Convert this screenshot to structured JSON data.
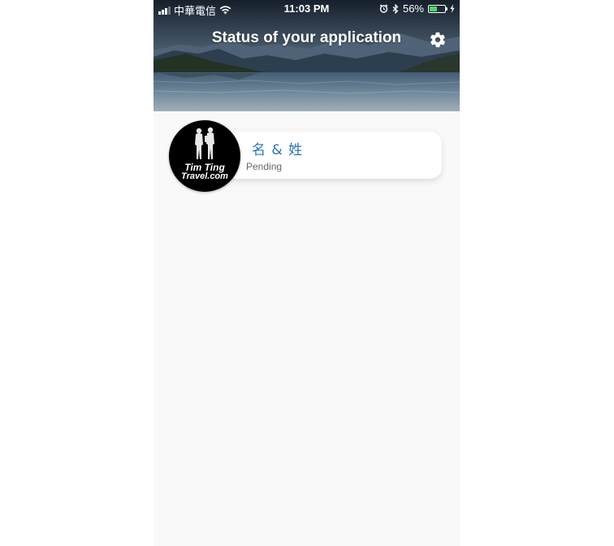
{
  "status_bar": {
    "carrier": "中華電信",
    "time": "11:03 PM",
    "battery_percent": "56%",
    "battery_level": 0.56,
    "battery_color": "#4cd964"
  },
  "header": {
    "title": "Status of your application",
    "settings_icon": "gear-icon"
  },
  "application": {
    "name": "名 & 姓",
    "status": "Pending",
    "avatar_logo": {
      "line1": "Tim Ting",
      "line2": "Travel.com"
    }
  },
  "colors": {
    "name_text": "#2a73b8",
    "status_text": "#666666",
    "background": "#faf9fa"
  }
}
